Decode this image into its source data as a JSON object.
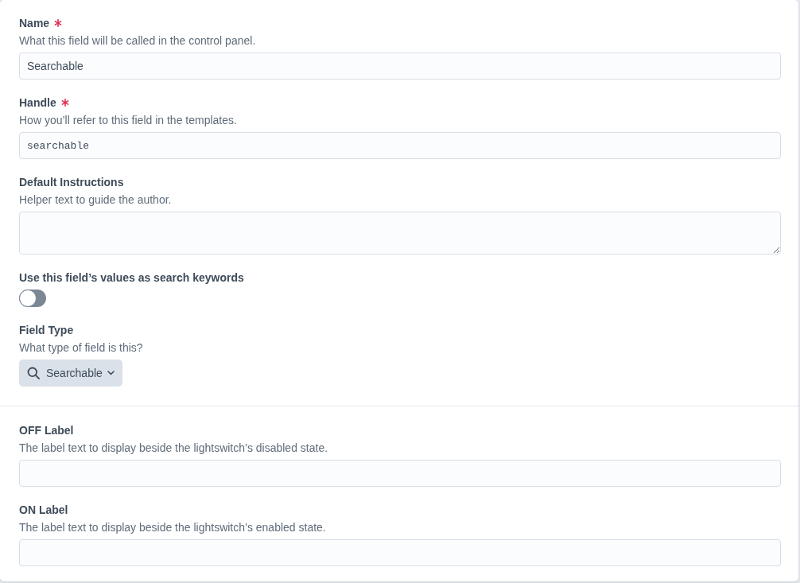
{
  "sections": [
    {
      "fields": [
        {
          "kind": "text",
          "label": "Name",
          "required": true,
          "instructions": "What this field will be called in the control panel.",
          "value": "Searchable"
        },
        {
          "kind": "code",
          "label": "Handle",
          "required": true,
          "instructions": "How you’ll refer to this field in the templates.",
          "value": "searchable"
        },
        {
          "kind": "textarea",
          "label": "Default Instructions",
          "required": false,
          "instructions": "Helper text to guide the author."
        },
        {
          "kind": "toggle",
          "label": "Use this field’s values as search keywords",
          "required": false,
          "on": false
        },
        {
          "kind": "select",
          "label": "Field Type",
          "required": false,
          "instructions": "What type of field is this?",
          "value": "Searchable"
        }
      ]
    },
    {
      "fields": [
        {
          "kind": "text",
          "label": "OFF Label",
          "required": false,
          "instructions": "The label text to display beside the lightswitch’s disabled state."
        },
        {
          "kind": "text",
          "label": "ON Label",
          "required": false,
          "instructions": "The label text to display beside the lightswitch’s enabled state."
        }
      ]
    }
  ]
}
